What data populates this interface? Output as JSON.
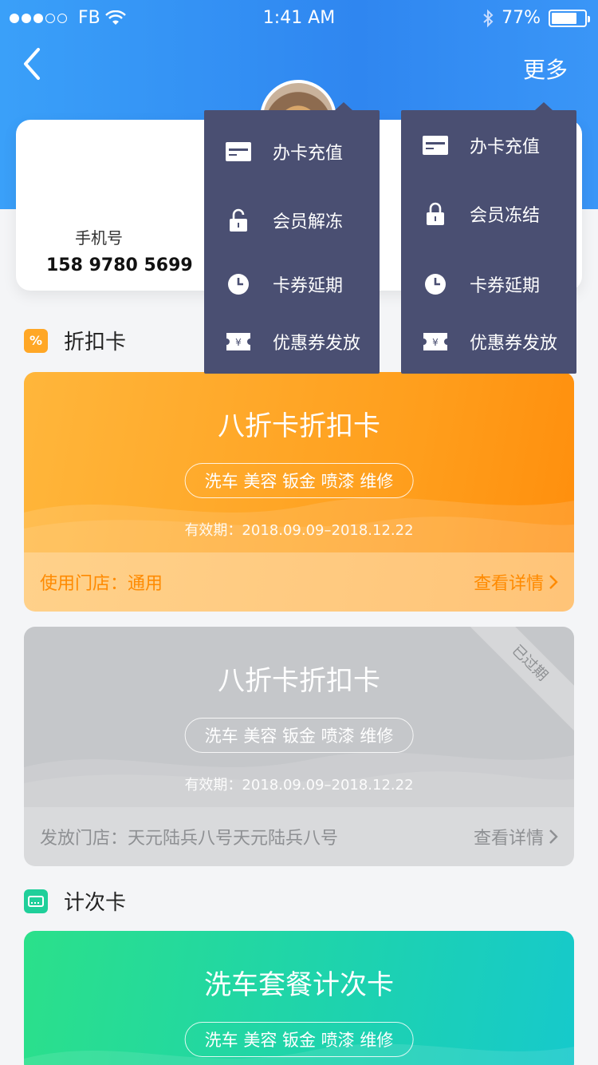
{
  "status_bar": {
    "carrier": "FB",
    "time": "1:41 AM",
    "battery": "77%",
    "battery_level": 0.77
  },
  "nav": {
    "more_label": "更多"
  },
  "member": {
    "phone_label": "手机号",
    "phone_number": "158 9780 5699"
  },
  "menus": [
    {
      "items": [
        {
          "label": "办卡充值",
          "icon": "card-icon"
        },
        {
          "label": "会员解冻",
          "icon": "unlock-icon"
        },
        {
          "label": "卡券延期",
          "icon": "clock-icon"
        },
        {
          "label": "优惠券发放",
          "icon": "coupon-icon"
        }
      ]
    },
    {
      "items": [
        {
          "label": "办卡充值",
          "icon": "card-icon"
        },
        {
          "label": "会员冻结",
          "icon": "lock-icon"
        },
        {
          "label": "卡券延期",
          "icon": "clock-icon"
        },
        {
          "label": "优惠券发放",
          "icon": "coupon-icon"
        }
      ]
    }
  ],
  "sections": {
    "discount": {
      "title": "折扣卡",
      "icon_glyph": "%"
    },
    "count": {
      "title": "计次卡"
    }
  },
  "cards": [
    {
      "title": "八折卡折扣卡",
      "tags": "洗车 美容 钣金 喷漆 维修",
      "validity": "有效期：2018.09.09–2018.12.22",
      "store": "使用门店：通用",
      "details": "查看详情"
    },
    {
      "title": "八折卡折扣卡",
      "tags": "洗车 美容 钣金 喷漆 维修",
      "validity": "有效期：2018.09.09–2018.12.22",
      "store": "发放门店：天元陆兵八号天元陆兵八号",
      "details": "查看详情",
      "ribbon": "已过期"
    },
    {
      "title": "洗车套餐计次卡",
      "tags": "洗车 美容 钣金 喷漆 维修"
    }
  ],
  "colors": {
    "header_blue": "#3a96f7",
    "menu_bg": "#4a4f72",
    "orange": "#ff9e1c",
    "green": "#1dd2b0",
    "expired_gray": "#c5c7ca"
  }
}
